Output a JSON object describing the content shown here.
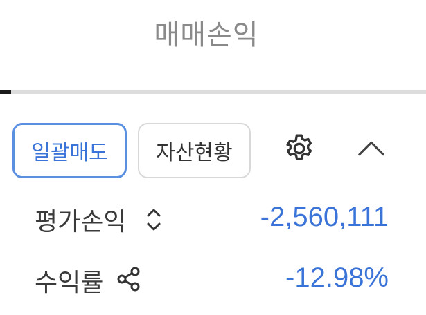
{
  "tab": {
    "title": "매매손익"
  },
  "actions": {
    "sell_all_label": "일괄매도",
    "asset_status_label": "자산현황"
  },
  "icons": {
    "settings": "gear-icon",
    "collapse": "chevron-up-icon",
    "sort": "sort-updown-icon",
    "share": "share-icon"
  },
  "summary": {
    "eval_pl_label": "평가손익",
    "eval_pl_value": "-2,560,111",
    "return_rate_label": "수익률",
    "return_rate_value": "-12.98%"
  },
  "colors": {
    "accent": "#3b74d8",
    "accent_border": "#5b8fe0",
    "title_gray": "#8a8a8a",
    "text_dark": "#3a3a3a"
  }
}
